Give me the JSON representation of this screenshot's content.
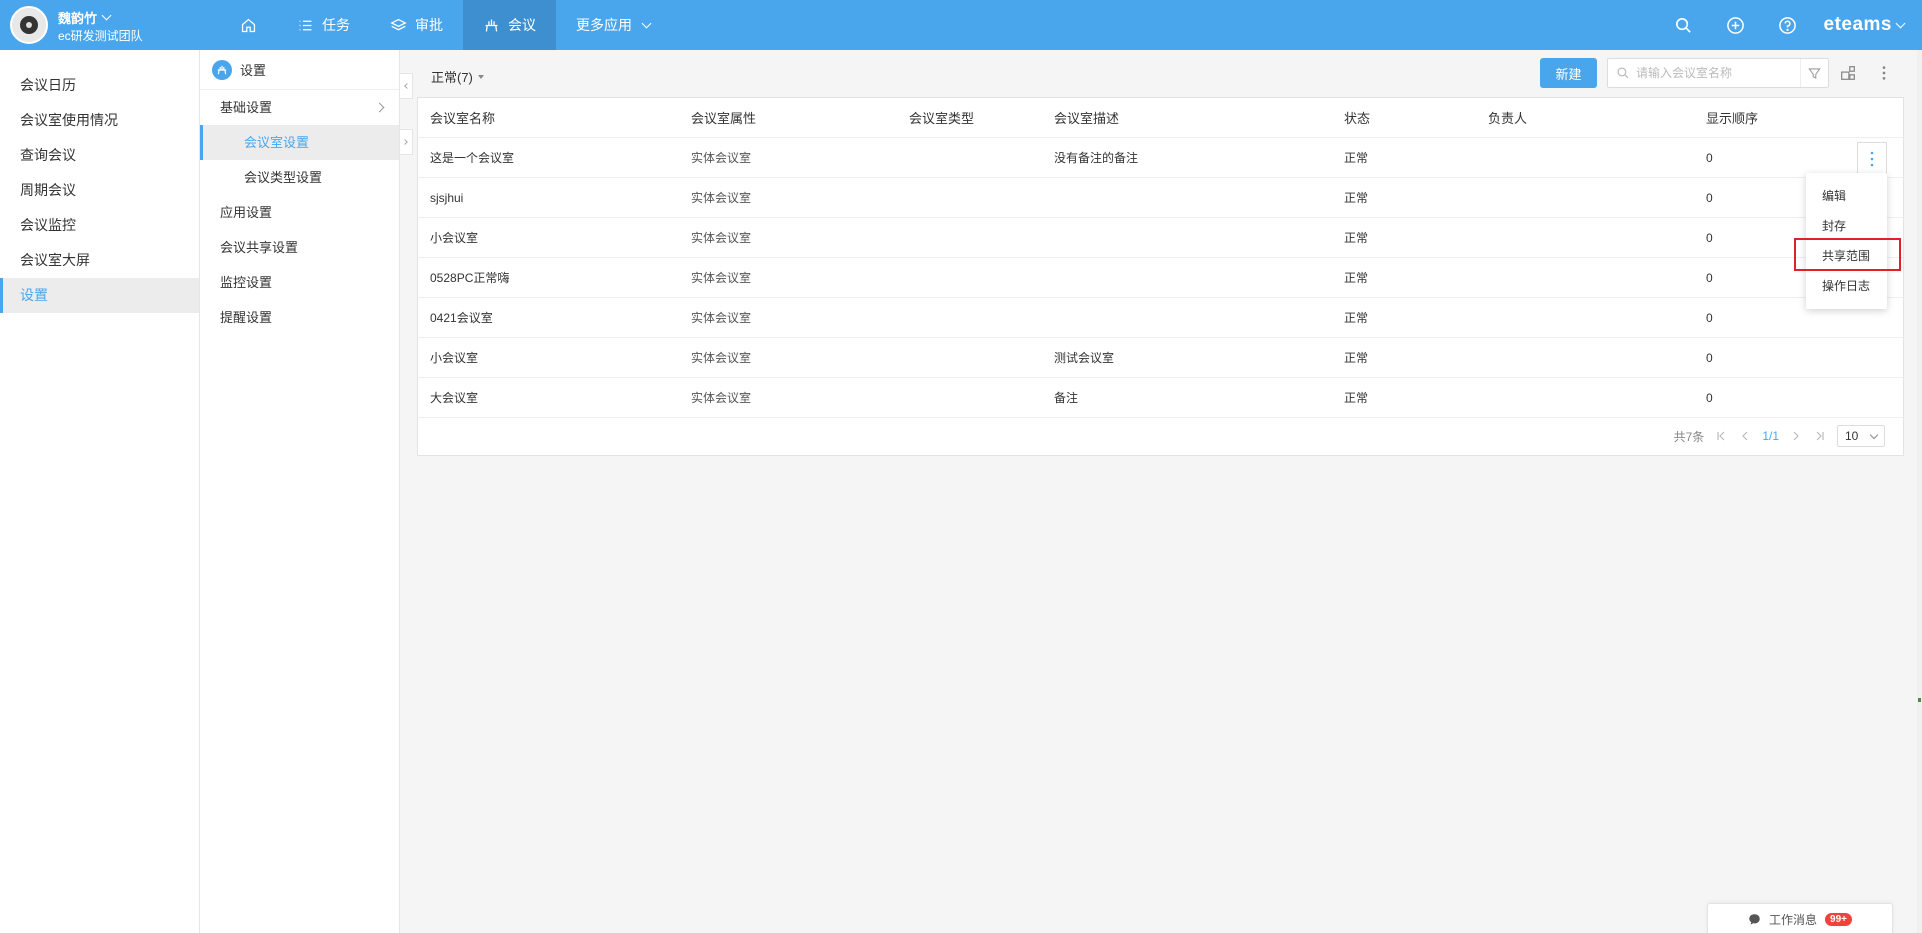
{
  "user": {
    "name": "魏韵竹",
    "team": "ec研发测试团队"
  },
  "nav": [
    {
      "label": "",
      "icon": "home-icon"
    },
    {
      "label": "任务",
      "icon": "list-icon"
    },
    {
      "label": "审批",
      "icon": "layers-icon"
    },
    {
      "label": "会议",
      "icon": "meeting-icon",
      "active": true
    },
    {
      "label": "更多应用",
      "icon": "chevron-down-icon"
    }
  ],
  "brand": "eteams",
  "sidebar": {
    "items": [
      {
        "label": "会议日历"
      },
      {
        "label": "会议室使用情况"
      },
      {
        "label": "查询会议"
      },
      {
        "label": "周期会议"
      },
      {
        "label": "会议监控"
      },
      {
        "label": "会议室大屏"
      },
      {
        "label": "设置",
        "active": true
      }
    ]
  },
  "settings_menu": {
    "title": "设置",
    "items": [
      {
        "label": "基础设置"
      },
      {
        "label": "会议室设置",
        "active": true
      },
      {
        "label": "会议类型设置"
      },
      {
        "label": "应用设置"
      },
      {
        "label": "会议共享设置"
      },
      {
        "label": "监控设置"
      },
      {
        "label": "提醒设置"
      }
    ]
  },
  "toolbar": {
    "status_filter": "正常(7)",
    "new_label": "新建",
    "search_placeholder": "请输入会议室名称"
  },
  "table": {
    "headers": [
      "会议室名称",
      "会议室属性",
      "会议室类型",
      "会议室描述",
      "状态",
      "负责人",
      "显示顺序"
    ],
    "rows": [
      [
        "这是一个会议室",
        "实体会议室",
        "",
        "没有备注的备注",
        "正常",
        "",
        "0"
      ],
      [
        "sjsjhui",
        "实体会议室",
        "",
        "",
        "正常",
        "",
        "0"
      ],
      [
        "小会议室",
        "实体会议室",
        "",
        "",
        "正常",
        "",
        "0"
      ],
      [
        "0528PC正常嗨",
        "实体会议室",
        "",
        "",
        "正常",
        "",
        "0"
      ],
      [
        "0421会议室",
        "实体会议室",
        "",
        "",
        "正常",
        "",
        "0"
      ],
      [
        "小会议室",
        "实体会议室",
        "",
        "测试会议室",
        "正常",
        "",
        "0"
      ],
      [
        "大会议室",
        "实体会议室",
        "",
        "备注",
        "正常",
        "",
        "0"
      ]
    ]
  },
  "row_menu": {
    "items": [
      "编辑",
      "封存",
      "共享范围",
      "操作日志"
    ],
    "highlighted": "共享范围"
  },
  "pager": {
    "total": "共7条",
    "page": "1/1",
    "page_size": "10"
  },
  "work_msg": {
    "label": "工作消息",
    "badge": "99+"
  },
  "colors": {
    "primary": "#4aa6ec",
    "highlight": "#e0202a",
    "badge": "#f0433b"
  }
}
